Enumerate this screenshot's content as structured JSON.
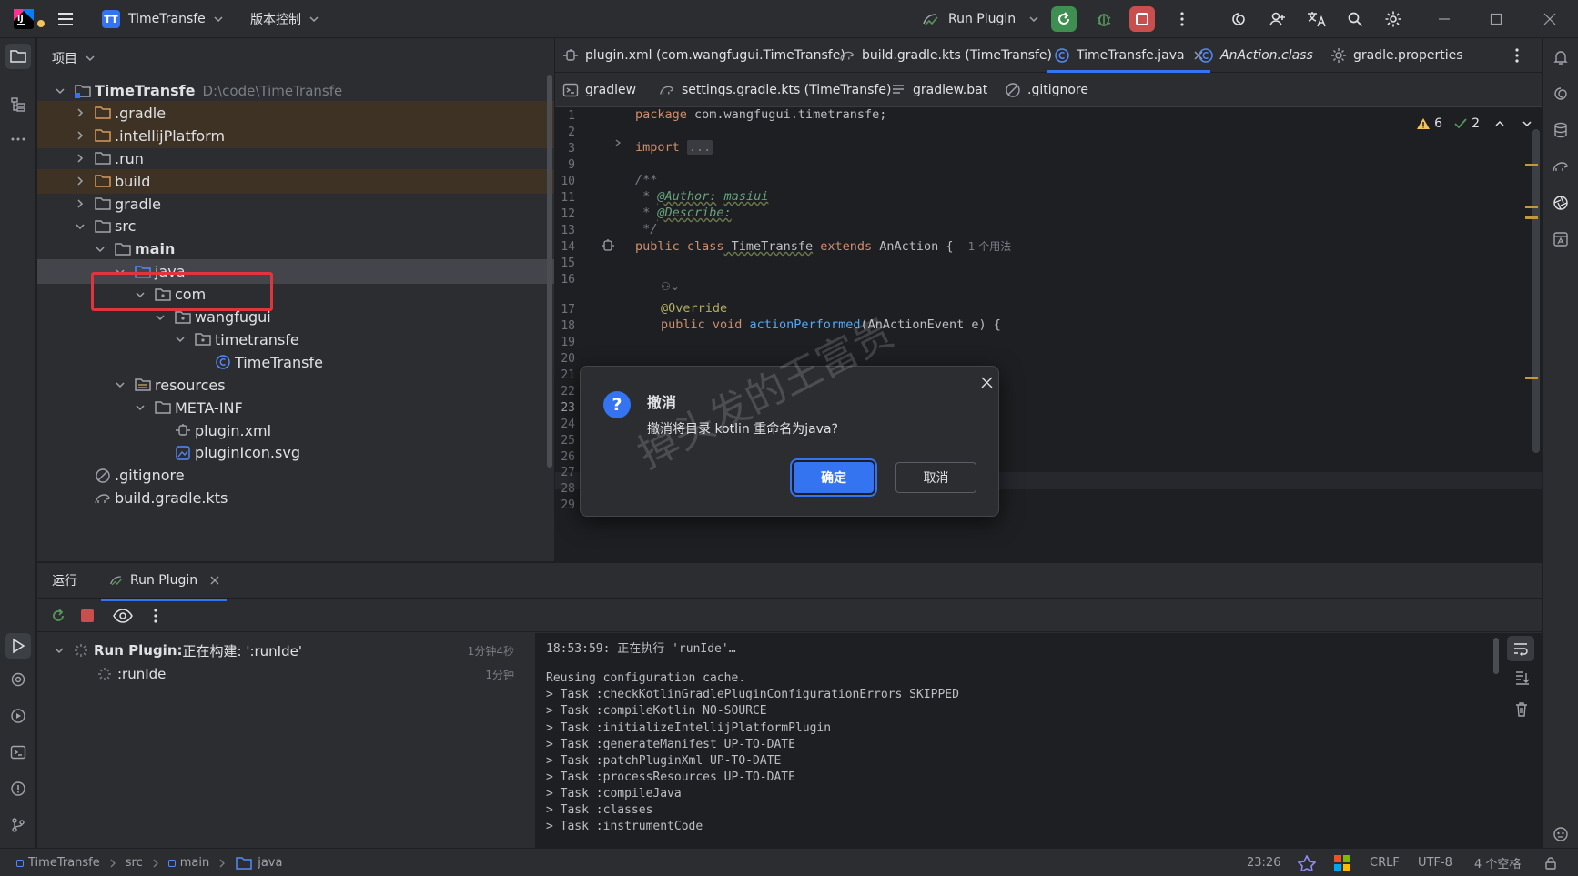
{
  "titlebar": {
    "project_badge": "TT",
    "project_name": "TimeTransfe",
    "vcs_label": "版本控制",
    "run_config": "Run Plugin",
    "window_controls": [
      "minimize",
      "maximize",
      "close"
    ]
  },
  "project_panel": {
    "header": "项目",
    "tree": [
      {
        "label": "TimeTransfe",
        "path": "D:\\code\\TimeTransfe",
        "depth": 0,
        "icon": "module-folder-icon",
        "expanded": true,
        "bold": true
      },
      {
        "label": ".gradle",
        "depth": 1,
        "icon": "folder-excluded-icon",
        "expanded": false,
        "excluded": true
      },
      {
        "label": ".intellijPlatform",
        "depth": 1,
        "icon": "folder-excluded-icon",
        "expanded": false,
        "excluded": true
      },
      {
        "label": ".run",
        "depth": 1,
        "icon": "folder-icon",
        "expanded": false
      },
      {
        "label": "build",
        "depth": 1,
        "icon": "folder-excluded-icon",
        "expanded": false,
        "excluded": true
      },
      {
        "label": "gradle",
        "depth": 1,
        "icon": "folder-icon",
        "expanded": false
      },
      {
        "label": "src",
        "depth": 1,
        "icon": "folder-icon",
        "expanded": true
      },
      {
        "label": "main",
        "depth": 2,
        "icon": "folder-icon",
        "expanded": true,
        "bold": true
      },
      {
        "label": "java",
        "depth": 3,
        "icon": "source-folder-icon",
        "expanded": true,
        "selected": true
      },
      {
        "label": "com",
        "depth": 4,
        "icon": "package-icon",
        "expanded": true
      },
      {
        "label": "wangfugui",
        "depth": 5,
        "icon": "package-icon",
        "expanded": true
      },
      {
        "label": "timetransfe",
        "depth": 6,
        "icon": "package-icon",
        "expanded": true
      },
      {
        "label": "TimeTransfe",
        "depth": 7,
        "icon": "class-icon",
        "leaf": true
      },
      {
        "label": "resources",
        "depth": 3,
        "icon": "resources-folder-icon",
        "expanded": true
      },
      {
        "label": "META-INF",
        "depth": 4,
        "icon": "folder-icon",
        "expanded": true
      },
      {
        "label": "plugin.xml",
        "depth": 5,
        "icon": "plugin-xml-icon",
        "leaf": true
      },
      {
        "label": "pluginIcon.svg",
        "depth": 5,
        "icon": "svg-file-icon",
        "leaf": true
      },
      {
        "label": ".gitignore",
        "depth": 1,
        "icon": "ignore-file-icon",
        "leaf": true
      },
      {
        "label": "build.gradle.kts",
        "depth": 1,
        "icon": "gradle-file-icon",
        "leaf": true
      }
    ]
  },
  "editor": {
    "tabs_row1": [
      {
        "label": "plugin.xml (com.wangfugui.TimeTransfe)",
        "icon": "plugin-xml-icon"
      },
      {
        "label": "build.gradle.kts (TimeTransfe)",
        "icon": "gradle-file-icon"
      },
      {
        "label": "TimeTransfe.java",
        "icon": "class-icon",
        "active": true,
        "closable": true
      },
      {
        "label": "AnAction.class",
        "icon": "class-icon",
        "italic": true
      },
      {
        "label": "gradle.properties",
        "icon": "gear-icon"
      }
    ],
    "tabs_row2": [
      {
        "label": "gradlew",
        "icon": "terminal-file-icon"
      },
      {
        "label": "settings.gradle.kts (TimeTransfe)",
        "icon": "gradle-file-icon"
      },
      {
        "label": "gradlew.bat",
        "icon": "text-file-icon"
      },
      {
        "label": ".gitignore",
        "icon": "ignore-file-icon"
      }
    ],
    "inspections": {
      "warnings": "6",
      "ok": "2"
    },
    "line_numbers": [
      "1",
      "2",
      "3",
      "9",
      "10",
      "11",
      "12",
      "13",
      "14",
      "15",
      "16",
      "17",
      "18",
      "19",
      "20",
      "21",
      "22",
      "23",
      "24",
      "25",
      "26",
      "27",
      "28",
      "29"
    ],
    "code": {
      "package_kw": "package",
      "package_name": " com.wangfugui.timetransfe;",
      "import_kw": "import",
      "import_fold": "...",
      "doc_open": "/**",
      "author_tag": "@Author:",
      "author_val": "masiui",
      "describe_tag": "@Describe:",
      "doc_close": "*/",
      "class_decl_kw1": "public class",
      "class_name": " TimeTransfe",
      "class_extends": " extends",
      "class_parent": " AnAction {",
      "usage_hint": "1 个用法",
      "override": "@Override",
      "method_kw": "public void",
      "method_name": " actionPerformed",
      "method_params": "(AnActionEvent e) {",
      "close_brace": "}"
    }
  },
  "dialog": {
    "title": "撤消",
    "message": "撤消将目录 kotlin 重命名为java?",
    "ok_label": "确定",
    "cancel_label": "取消"
  },
  "watermark": "掉头发的王富贵",
  "run_panel": {
    "tab_run": "运行",
    "tab_config": "Run Plugin",
    "tree": [
      {
        "label_bold": "Run Plugin:",
        "label_rest": " 正在构建: ':runIde'",
        "time": "1分钟4秒"
      },
      {
        "label_bold": "",
        "label_rest": ":runIde",
        "time": "1分钟"
      }
    ],
    "console": [
      "18:53:59: 正在执行 'runIde'…",
      "",
      "Reusing configuration cache.",
      "> Task :checkKotlinGradlePluginConfigurationErrors SKIPPED",
      "> Task :compileKotlin NO-SOURCE",
      "> Task :initializeIntellijPlatformPlugin",
      "> Task :generateManifest UP-TO-DATE",
      "> Task :patchPluginXml UP-TO-DATE",
      "> Task :processResources UP-TO-DATE",
      "> Task :compileJava",
      "> Task :classes",
      "> Task :instrumentCode"
    ]
  },
  "statusbar": {
    "crumbs": [
      "TimeTransfe",
      "src",
      "main",
      "java"
    ],
    "position": "23:26",
    "line_sep": "CRLF",
    "encoding": "UTF-8",
    "indent": "4 个空格"
  }
}
